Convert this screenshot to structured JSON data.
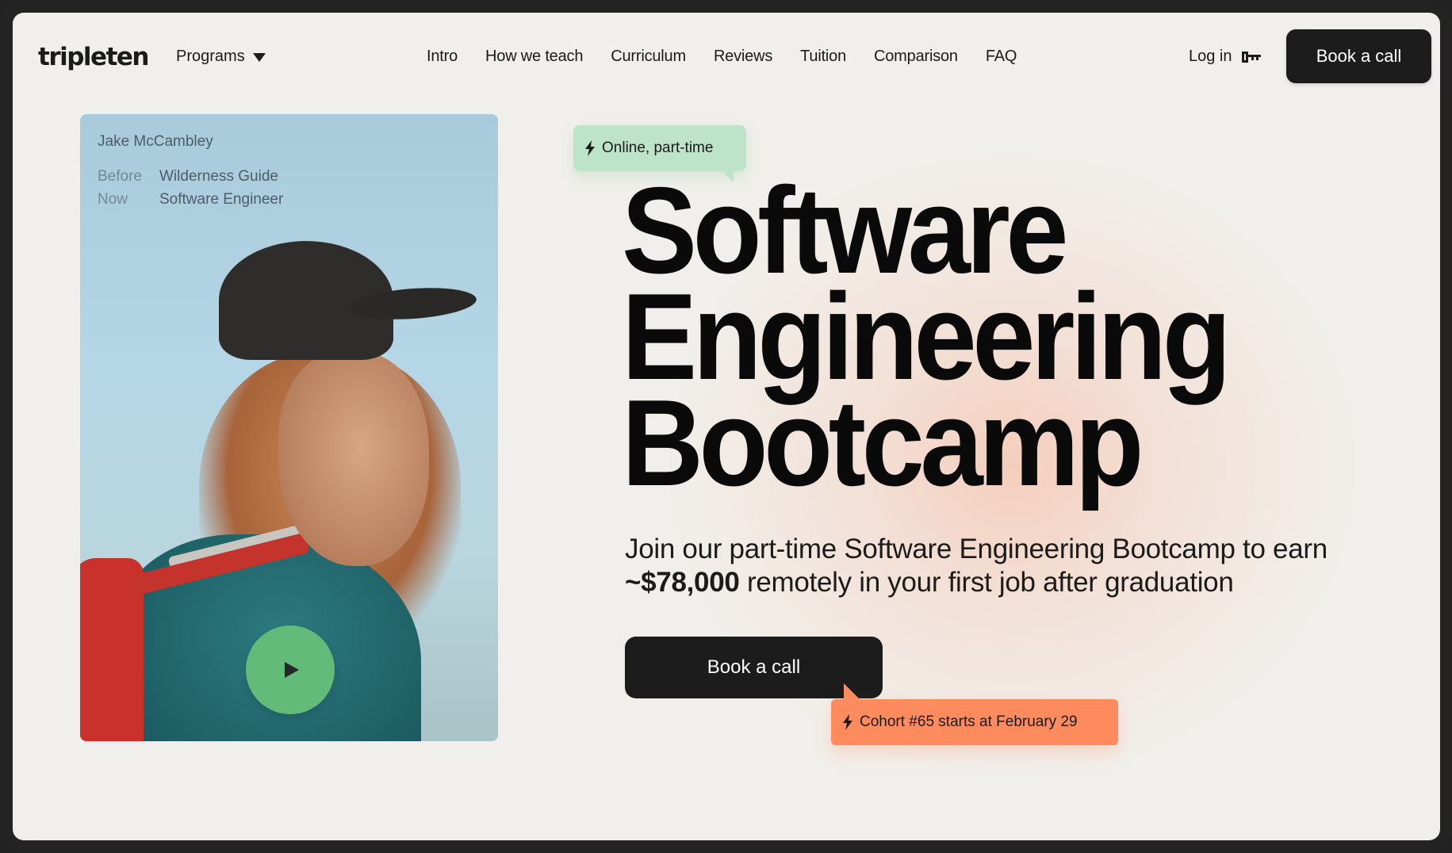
{
  "header": {
    "logo": "tripleten",
    "programs_label": "Programs",
    "nav": [
      "Intro",
      "How we teach",
      "Curriculum",
      "Reviews",
      "Tuition",
      "Comparison",
      "FAQ"
    ],
    "login_label": "Log in",
    "cta_label": "Book a call"
  },
  "testimonial": {
    "name": "Jake McCambley",
    "before_label": "Before",
    "before_value": "Wilderness Guide",
    "now_label": "Now",
    "now_value": "Software Engineer",
    "play_icon": "play-icon"
  },
  "hero": {
    "badge": "Online, part-time",
    "title_lines": [
      "Software",
      "Engineering",
      "Bootcamp"
    ],
    "subtitle_pre": "Join our part-time Software Engineering Bootcamp to earn ",
    "subtitle_highlight": "~$78,000",
    "subtitle_post": " remotely in your first job after graduation",
    "cta_label": "Book a call",
    "cohort_note": "Cohort #65 starts at February 29"
  },
  "colors": {
    "background": "#f1efeb",
    "frame": "#232323",
    "button": "#1c1c1c",
    "badge_green": "#bde3c8",
    "badge_orange": "#fe8b5e",
    "play_green": "#63bb7a"
  }
}
